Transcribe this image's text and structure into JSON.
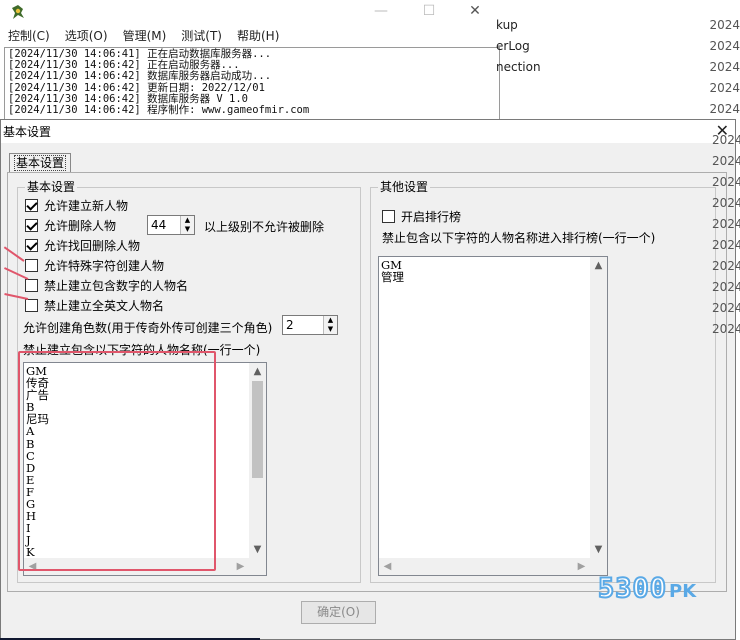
{
  "bg_window": {
    "menu": [
      "控制(C)",
      "选项(O)",
      "管理(M)",
      "测试(T)",
      "帮助(H)"
    ],
    "log_lines": [
      "[2024/11/30 14:06:41] 正在启动数据库服务器...",
      "[2024/11/30 14:06:42] 正在启动服务器...",
      "[2024/11/30 14:06:42] 数据库服务器启动成功...",
      "[2024/11/30 14:06:42] 更新日期: 2022/12/01",
      "[2024/11/30 14:06:42] 数据库服务器 V 1.0",
      "[2024/11/30 14:06:42] 程序制作: www.gameofmir.com"
    ],
    "window_controls": {
      "minimize": "—",
      "maximize": "☐",
      "close": "✕"
    }
  },
  "explorer_fragment": {
    "files": [
      "kup",
      "erLog",
      "nection"
    ],
    "dates": [
      "2024",
      "2024",
      "2024",
      "2024",
      "2024"
    ],
    "side_dates": [
      "2024",
      "2024",
      "2024",
      "2024",
      "2024",
      "2024",
      "2024",
      "2024",
      "2024",
      "2024",
      "2024"
    ]
  },
  "dialog": {
    "title": "基本设置",
    "close": "✕",
    "tab": "基本设置",
    "basic": {
      "title": "基本设置",
      "checkboxes": [
        {
          "label": "允许建立新人物",
          "checked": true
        },
        {
          "label": "允许删除人物",
          "checked": true
        },
        {
          "label": "允许找回删除人物",
          "checked": true
        },
        {
          "label": "允许特殊字符创建人物",
          "checked": false
        },
        {
          "label": "禁止建立包含数字的人物名",
          "checked": false
        },
        {
          "label": "禁止建立全英文人物名",
          "checked": false
        }
      ],
      "delete_level_value": "44",
      "delete_level_suffix": "以上级别不允许被删除",
      "char_count_label": "允许创建角色数(用于传奇外传可创建三个角色)",
      "char_count_value": "2",
      "forbidden_label": "禁止建立包含以下字符的人物名称(一行一个)",
      "forbidden_list": [
        "GM",
        "传奇",
        "广告",
        "B",
        "尼玛",
        "A",
        "B",
        "C",
        "D",
        "E",
        "F",
        "G",
        "H",
        "I",
        "J",
        "K"
      ]
    },
    "other": {
      "title": "其他设置",
      "ranking_checkbox": {
        "label": "开启排行榜",
        "checked": false
      },
      "ranking_exclude_label": "禁止包含以下字符的人物名称进入排行榜(一行一个)",
      "ranking_exclude_list": [
        "GM",
        "管理"
      ]
    },
    "ok_button": "确定(O)"
  },
  "watermark": {
    "digits": "5300",
    "suffix": "PK"
  },
  "colors": {
    "highlight": "#e0566b",
    "watermark": "#5aa9e6"
  }
}
